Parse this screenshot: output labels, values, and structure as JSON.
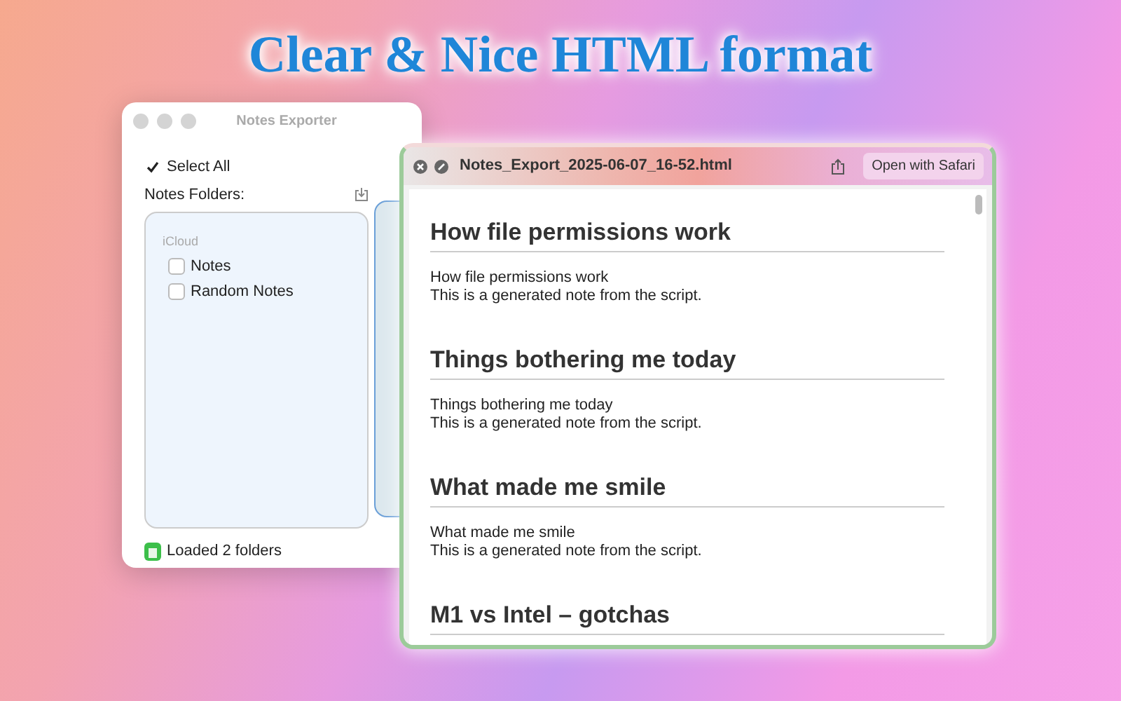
{
  "headline": "Clear & Nice HTML format",
  "main_window": {
    "title": "Notes Exporter",
    "select_all": {
      "label": "Select All",
      "checked": true
    },
    "folders_label": "Notes Folders:",
    "folders": [
      {
        "label": "iCloud",
        "children": [
          {
            "label": "Notes",
            "checked": false
          },
          {
            "label": "Random Notes",
            "checked": false
          }
        ]
      }
    ],
    "status": "Loaded 2 folders"
  },
  "preview_window": {
    "title": "Notes_Export_2025-06-07_16-52.html",
    "open_button": "Open with Safari",
    "notes": [
      {
        "heading": "How file permissions work",
        "lines": [
          "How file permissions work",
          "This is a generated note from the script."
        ]
      },
      {
        "heading": "Things bothering me today",
        "lines": [
          "Things bothering me today",
          "This is a generated note from the script."
        ]
      },
      {
        "heading": "What made me smile",
        "lines": [
          "What made me smile",
          "This is a generated note from the script."
        ]
      },
      {
        "heading": "M1 vs Intel – gotchas"
      }
    ]
  }
}
